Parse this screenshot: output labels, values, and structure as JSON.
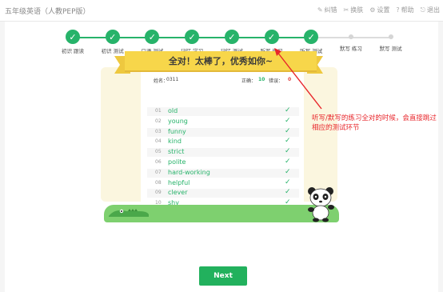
{
  "app": {
    "title": "五年级英语（人教PEP版）"
  },
  "toolbar": [
    {
      "icon": "pencil-icon",
      "glyph": "✎",
      "label": "纠错"
    },
    {
      "icon": "shirt-icon",
      "glyph": "✂",
      "label": "换肤"
    },
    {
      "icon": "gear-icon",
      "glyph": "⚙",
      "label": "设置"
    },
    {
      "icon": "help-icon",
      "glyph": "?",
      "label": "帮助"
    },
    {
      "icon": "exit-icon",
      "glyph": "⎋",
      "label": "退出"
    }
  ],
  "steps": [
    {
      "label": "初识 跟读",
      "done": true
    },
    {
      "label": "初识 测试",
      "done": true
    },
    {
      "label": "口语 测试",
      "done": true
    },
    {
      "label": "记忆 学习",
      "done": true
    },
    {
      "label": "记忆 测试",
      "done": true
    },
    {
      "label": "听写 练习",
      "done": true
    },
    {
      "label": "听写 测试",
      "done": true
    },
    {
      "label": "默写 练习",
      "done": false
    },
    {
      "label": "默写 测试",
      "done": false
    }
  ],
  "result": {
    "banner": "全对！太棒了，优秀如你~",
    "name_label": "姓名：",
    "name_value": "0311",
    "correct_label": "正确：",
    "correct_value": "10",
    "wrong_label": "错误：",
    "wrong_value": "0"
  },
  "words": [
    {
      "num": "01",
      "word": "old"
    },
    {
      "num": "02",
      "word": "young"
    },
    {
      "num": "03",
      "word": "funny"
    },
    {
      "num": "04",
      "word": "kind"
    },
    {
      "num": "05",
      "word": "strict"
    },
    {
      "num": "06",
      "word": "polite"
    },
    {
      "num": "07",
      "word": "hard-working"
    },
    {
      "num": "08",
      "word": "helpful"
    },
    {
      "num": "09",
      "word": "clever"
    },
    {
      "num": "10",
      "word": "shy"
    }
  ],
  "annotation": "听写/默写的练习全对的时候，会直接跳过相应的测试环节",
  "next_button": "Next",
  "colors": {
    "accent": "#27b36a",
    "annotation": "#e8262b",
    "banner": "#f7d64a"
  }
}
